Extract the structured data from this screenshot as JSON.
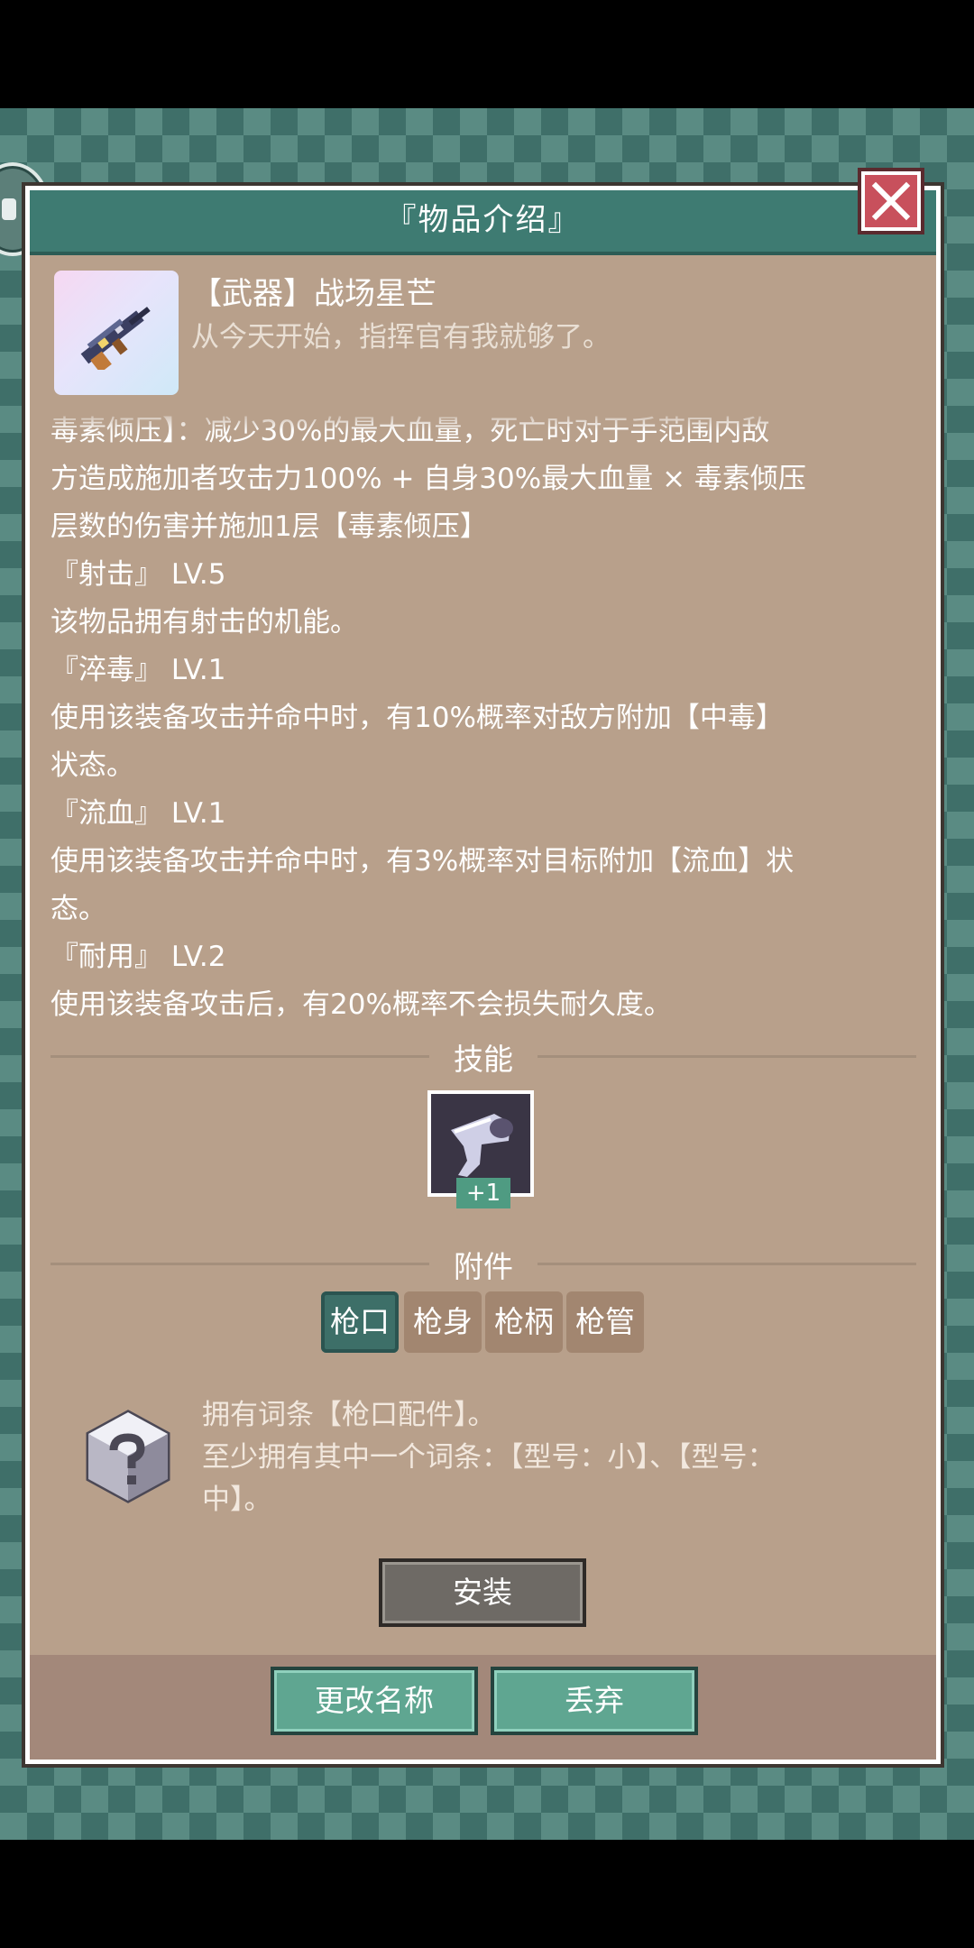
{
  "dialog": {
    "title": "『物品介绍』"
  },
  "item": {
    "name": "【武器】战场星芒",
    "quote": "从今天开始，指挥官有我就够了。",
    "icon": "rifle-icon"
  },
  "description": {
    "lines": [
      "毒素倾压】：减少30%的最大血量，死亡时对于手范围内敌",
      "方造成施加者攻击力100% + 自身30%最大血量 × 毒素倾压",
      "层数的伤害并施加1层【毒素倾压】",
      "『射击』 LV.5",
      "该物品拥有射击的机能。",
      "『淬毒』 LV.1",
      "使用该装备攻击并命中时，有10%概率对敌方附加【中毒】",
      "状态。",
      "『流血』 LV.1",
      "使用该装备攻击并命中时，有3%概率对目标附加【流血】状",
      "态。",
      "『耐用』 LV.2",
      "使用该装备攻击后，有20%概率不会损失耐久度。"
    ]
  },
  "skills": {
    "title": "技能",
    "icon": "boot-kick-icon",
    "level": "+1"
  },
  "attachments": {
    "title": "附件",
    "tabs": [
      "枪口",
      "枪身",
      "枪柄",
      "枪管"
    ],
    "active_tab": "枪口",
    "slot_icon": "mystery-box-icon",
    "slot_lines": [
      "拥有词条【枪口配件】。",
      "至少拥有其中一个词条：【型号：小】、【型号：",
      "中】。"
    ],
    "install_label": "安装"
  },
  "footer": {
    "rename_label": "更改名称",
    "discard_label": "丢弃"
  }
}
